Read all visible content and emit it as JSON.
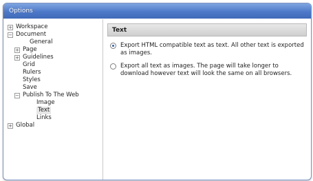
{
  "window": {
    "title": "Options"
  },
  "tree": {
    "items": [
      {
        "label": "Workspace",
        "expander": "+",
        "indent": 0,
        "selected": false
      },
      {
        "label": "Document",
        "expander": "−",
        "indent": 0,
        "selected": false
      },
      {
        "label": "General",
        "expander": "",
        "indent": 2,
        "selected": false
      },
      {
        "label": "Page",
        "expander": "+",
        "indent": 1,
        "selected": false
      },
      {
        "label": "Guidelines",
        "expander": "+",
        "indent": 1,
        "selected": false
      },
      {
        "label": "Grid",
        "expander": "",
        "indent": 1,
        "selected": false
      },
      {
        "label": "Rulers",
        "expander": "",
        "indent": 1,
        "selected": false
      },
      {
        "label": "Styles",
        "expander": "",
        "indent": 1,
        "selected": false
      },
      {
        "label": "Save",
        "expander": "",
        "indent": 1,
        "selected": false
      },
      {
        "label": "Publish To The Web",
        "expander": "−",
        "indent": 1,
        "selected": false
      },
      {
        "label": "Image",
        "expander": "",
        "indent": 3,
        "selected": false
      },
      {
        "label": "Text",
        "expander": "",
        "indent": 3,
        "selected": true
      },
      {
        "label": "Links",
        "expander": "",
        "indent": 3,
        "selected": false
      },
      {
        "label": "Global",
        "expander": "+",
        "indent": 0,
        "selected": false
      }
    ]
  },
  "panel": {
    "header": "Text",
    "options": [
      {
        "text": "Export HTML compatible text as text. All other text is exported as images.",
        "checked": true
      },
      {
        "text": "Export all text as images. The page will take longer to download however text will look the same on all browsers.",
        "checked": false
      }
    ]
  }
}
